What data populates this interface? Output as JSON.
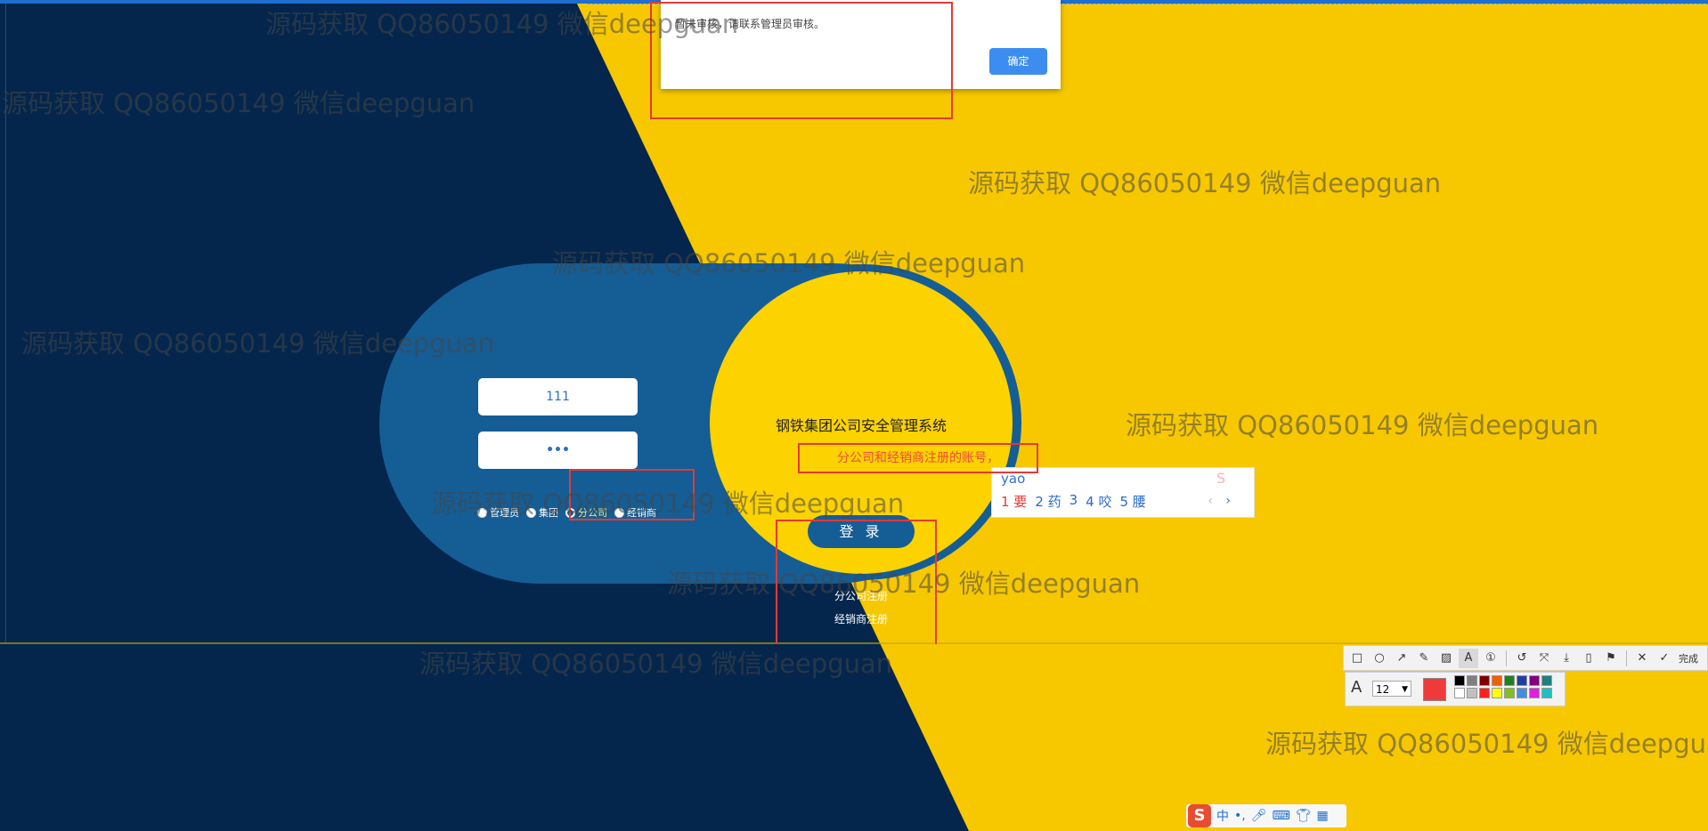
{
  "alert": {
    "message": "暂未审核，请联系管理员审核。",
    "ok_label": "确定"
  },
  "login": {
    "username_value": "111",
    "password_mask": "•••",
    "roles": [
      {
        "label": "管理员",
        "checked": false
      },
      {
        "label": "集团",
        "checked": false
      },
      {
        "label": "分公司",
        "checked": true
      },
      {
        "label": "经销商",
        "checked": false
      }
    ],
    "system_title": "钢铁集团公司安全管理系统",
    "info_text": "分公司和经销商注册的账号，",
    "login_label": "登 录",
    "register_branch": "分公司注册",
    "register_dealer": "经销商注册"
  },
  "ime": {
    "pinyin": "yao",
    "candidates": [
      "1 要",
      "2 药",
      "3",
      "4 咬",
      "5 腰"
    ],
    "prev": "‹",
    "next": "›"
  },
  "screenshot_tool": {
    "font_size": "12",
    "done_label": "完成",
    "current_color": "#f03a3a",
    "palette": [
      "#000000",
      "#808080",
      "#800000",
      "#f06000",
      "#208020",
      "#2040a0",
      "#800080",
      "#208080",
      "#ffffff",
      "#c0c0c0",
      "#ff2020",
      "#ffff00",
      "#80c020",
      "#4090e0",
      "#e020e0",
      "#20c0c0"
    ]
  },
  "taskbar": {
    "ime_mode": "中"
  },
  "watermark": {
    "text": "源码获取 QQ86050149 微信deepguan"
  },
  "colors": {
    "navy": "#04264d",
    "yellow": "#f7c800",
    "blue": "#155d95",
    "accent_red": "#e53935"
  }
}
